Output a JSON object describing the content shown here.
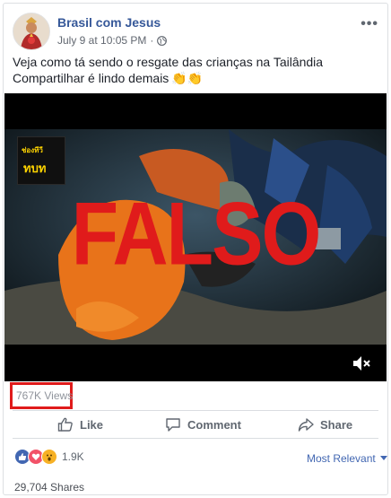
{
  "post": {
    "page_name": "Brasil com Jesus",
    "timestamp": "July 9 at 10:05 PM",
    "separator": "·",
    "privacy_icon": "globe-icon",
    "more_label": "•••",
    "text_line1": "Veja como tá sendo o resgate das crianças na Tailândia",
    "text_line2": "Compartilhar é lindo demais",
    "emoji": "👏👏"
  },
  "video": {
    "overlay_text": "FALSO",
    "channel_logo_top": "ช่องทีวี",
    "channel_logo_bottom": "ทบท",
    "mute_icon": "speaker-muted-icon"
  },
  "stats": {
    "views": "767K Views",
    "reaction_count": "1.9K",
    "shares": "29,704 Shares"
  },
  "actions": {
    "like": "Like",
    "comment": "Comment",
    "share": "Share"
  },
  "comments": {
    "sort_label": "Most Relevant",
    "sort_icon": "caret-down-icon"
  },
  "colors": {
    "link_blue": "#365899",
    "falso_red": "#e01b1b",
    "highlight_red": "#e01b1b",
    "like_blue": "#4267b2",
    "love_red": "#f25268",
    "wow_yellow": "#f7b125"
  }
}
